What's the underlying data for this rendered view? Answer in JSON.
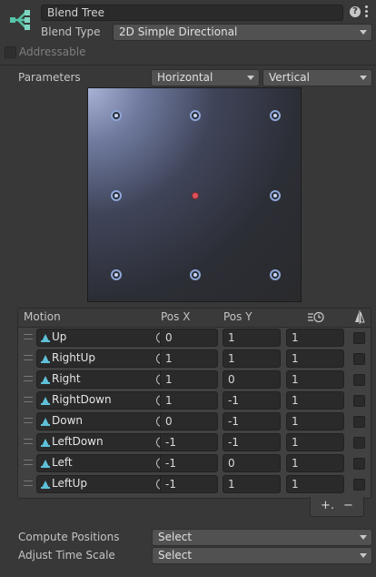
{
  "header": {
    "name_value": "Blend Tree",
    "blend_type_label": "Blend Type",
    "blend_type_value": "2D Simple Directional",
    "addressable_label": "Addressable"
  },
  "parameters": {
    "label": "Parameters",
    "x_param": "Horizontal",
    "y_param": "Vertical"
  },
  "table": {
    "headers": {
      "motion": "Motion",
      "pos_x": "Pos X",
      "pos_y": "Pos Y"
    },
    "rows": [
      {
        "name": "Up",
        "x": "0",
        "y": "1",
        "speed": "1"
      },
      {
        "name": "RightUp",
        "x": "1",
        "y": "1",
        "speed": "1"
      },
      {
        "name": "Right",
        "x": "1",
        "y": "0",
        "speed": "1"
      },
      {
        "name": "RightDown",
        "x": "1",
        "y": "-1",
        "speed": "1"
      },
      {
        "name": "Down",
        "x": "0",
        "y": "-1",
        "speed": "1"
      },
      {
        "name": "LeftDown",
        "x": "-1",
        "y": "-1",
        "speed": "1"
      },
      {
        "name": "Left",
        "x": "-1",
        "y": "0",
        "speed": "1"
      },
      {
        "name": "LeftUp",
        "x": "-1",
        "y": "1",
        "speed": "1"
      }
    ],
    "add_symbol": "+.",
    "remove_symbol": "−"
  },
  "bottom": {
    "compute_positions_label": "Compute Positions",
    "compute_positions_value": "Select",
    "adjust_time_scale_label": "Adjust Time Scale",
    "adjust_time_scale_value": "Select"
  },
  "icons": {
    "header": "blend-tree-icon",
    "help": "help-icon",
    "menu": "kebab-menu-icon",
    "time_scale": "time-scale-icon",
    "mirror": "mirror-icon",
    "clip": "animation-clip-icon",
    "picker": "object-picker-icon"
  },
  "colors": {
    "accent": "#8ea6d8",
    "center_marker": "#e0525c"
  }
}
